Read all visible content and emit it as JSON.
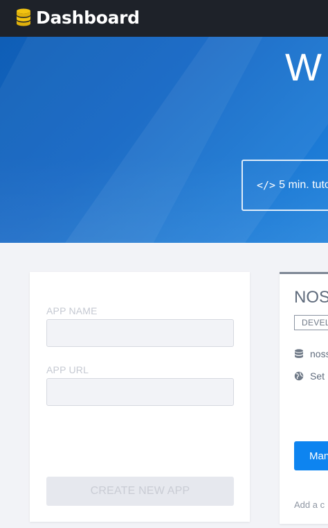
{
  "header": {
    "brand": "Dashboard",
    "logo_icon": "database-icon"
  },
  "hero": {
    "title": "W",
    "tutorial_label": "5 min. tuto",
    "tutorial_icon": "code-icon"
  },
  "create_form": {
    "app_name_label": "APP NAME",
    "app_name_value": "",
    "app_url_label": "APP URL",
    "app_url_value": "",
    "create_button": "CREATE NEW APP"
  },
  "app_card": {
    "name": "NOS",
    "environment": "DEVEL",
    "database_text": "noss",
    "url_text": "Set",
    "manage_button": "Man",
    "add_link": "Add a c"
  },
  "colors": {
    "topbar": "#1e2229",
    "hero_blue": "#1266c4",
    "primary_button": "#0d84f0",
    "logo_gold": "#f2c411"
  }
}
